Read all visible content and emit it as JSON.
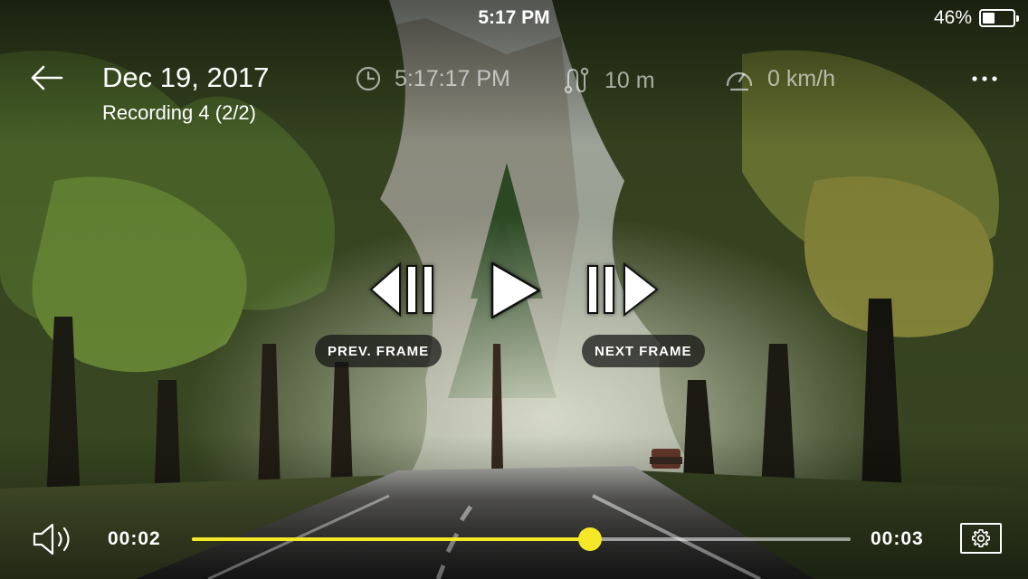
{
  "status_bar": {
    "time": "5:17 PM",
    "battery_percent_label": "46%",
    "battery_level": 0.46
  },
  "header": {
    "title": "Dec 19, 2017",
    "subtitle": "Recording 4 (2/2)",
    "meta": {
      "time": "5:17:17 PM",
      "distance": "10 m",
      "speed": "0 km/h"
    }
  },
  "controls": {
    "prev_label": "PREV. FRAME",
    "next_label": "NEXT FRAME"
  },
  "playback": {
    "current": "00:02",
    "duration": "00:03",
    "progress": 0.605
  },
  "colors": {
    "accent": "#F5E829",
    "overlay": "#141414"
  },
  "icons": {
    "back": "arrow-left-icon",
    "clock": "clock-icon",
    "route": "route-icon",
    "speed": "speedometer-icon",
    "more": "more-horizontal-icon",
    "prev": "step-backward-icon",
    "play": "play-icon",
    "next": "step-forward-icon",
    "volume": "volume-icon",
    "settings": "gear-icon"
  }
}
